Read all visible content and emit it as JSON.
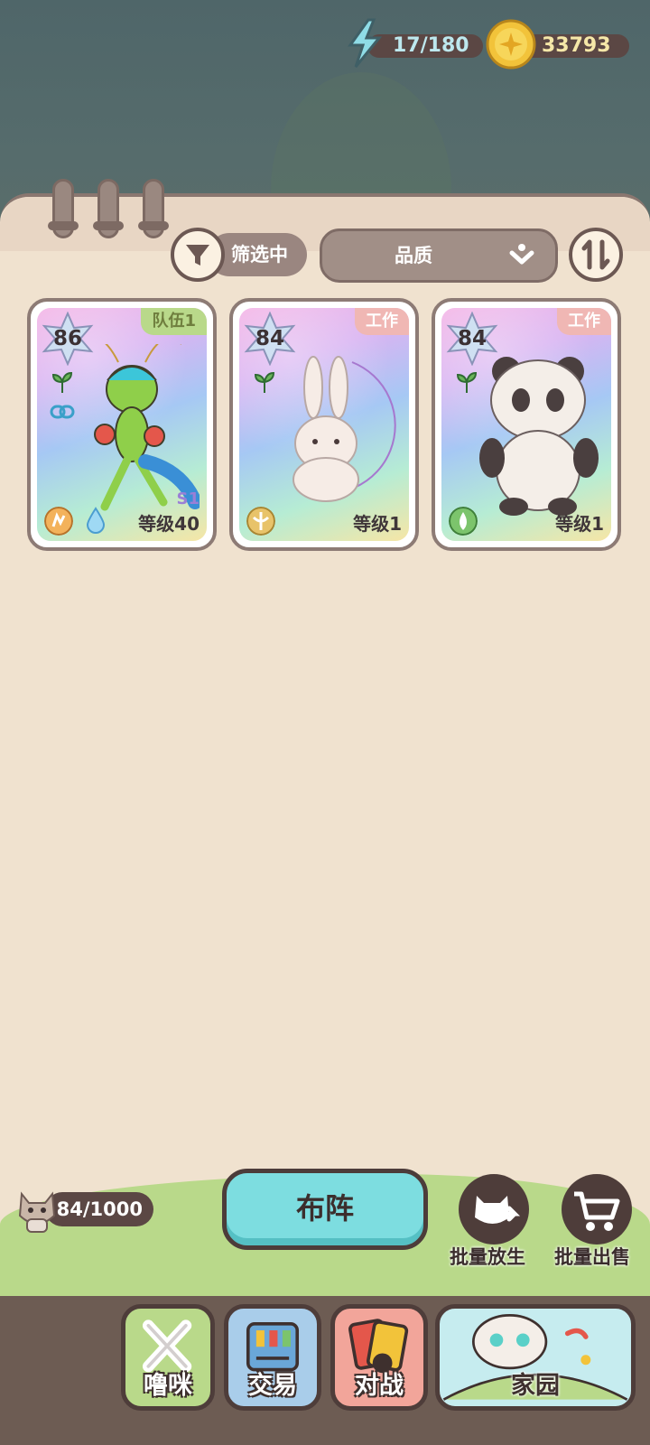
{
  "resources": {
    "energy": "17/180",
    "coins": "33793"
  },
  "toolbar": {
    "filter_label": "筛选中",
    "sort_label": "品质"
  },
  "cards": [
    {
      "level": "86",
      "status": "队伍1",
      "tier": "S1",
      "grade": "等级40",
      "creature": "mantis-boxer"
    },
    {
      "level": "84",
      "status": "工作",
      "grade": "等级1",
      "creature": "moon-rabbit"
    },
    {
      "level": "84",
      "status": "工作",
      "grade": "等级1",
      "creature": "panda"
    }
  ],
  "capacity": "84/1000",
  "actions": {
    "deploy": "布阵",
    "batch_release": "批量放生",
    "batch_sell": "批量出售"
  },
  "nav": [
    {
      "label": "噜咪",
      "icon": "x-icon"
    },
    {
      "label": "交易",
      "icon": "market-icon"
    },
    {
      "label": "对战",
      "icon": "battle-cards-icon"
    },
    {
      "label": "家园",
      "icon": "home-cat-icon"
    }
  ],
  "colors": {
    "accent": "#7ddde0",
    "panel": "#f0e2cf",
    "brown": "#4e3d3a",
    "team_tag": "#b9d98a",
    "work_tag": "#f0b7b4"
  }
}
